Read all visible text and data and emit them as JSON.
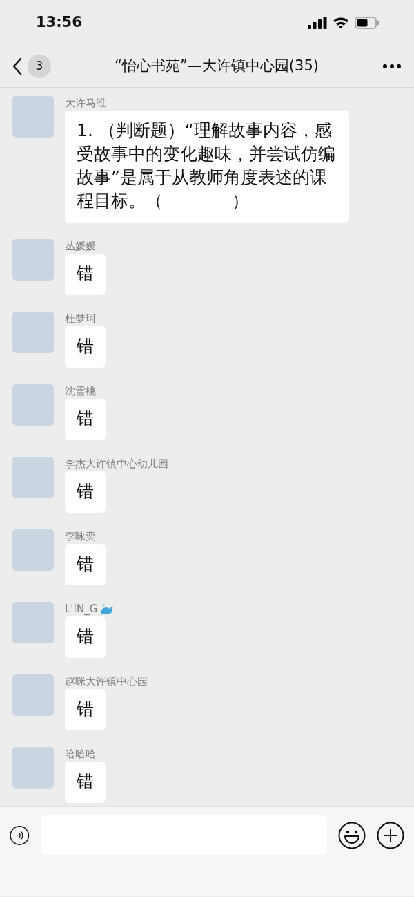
{
  "status_bar": {
    "time": "13:56"
  },
  "header": {
    "unread_count": "3",
    "title": "“怡心书苑”—大许镇中心园(35)"
  },
  "messages": [
    {
      "sender": "大许马维",
      "text": "1. （判断题）“理解故事内容，感受故事中的变化趣味，并尝试仿编故事”是属于从教师角度表述的课程目标。（　　　　）",
      "kind": "plain"
    },
    {
      "sender": "丛媛媛",
      "text": "错",
      "kind": "plain"
    },
    {
      "sender": "杜梦珂",
      "text": "错",
      "kind": "plain"
    },
    {
      "sender": "沈雪桃",
      "text": "错",
      "kind": "plain"
    },
    {
      "sender": "李杰大许镇中心幼儿园",
      "text": "错",
      "kind": "plain"
    },
    {
      "sender": "李咏奕",
      "text": "错",
      "kind": "plain"
    },
    {
      "sender": "L'IN_G",
      "text": "错",
      "kind": "whale"
    },
    {
      "sender": "赵咪大许镇中心园",
      "text": "错",
      "kind": "plain"
    },
    {
      "sender": "哈哈哈",
      "text": "错",
      "kind": "plain"
    }
  ]
}
